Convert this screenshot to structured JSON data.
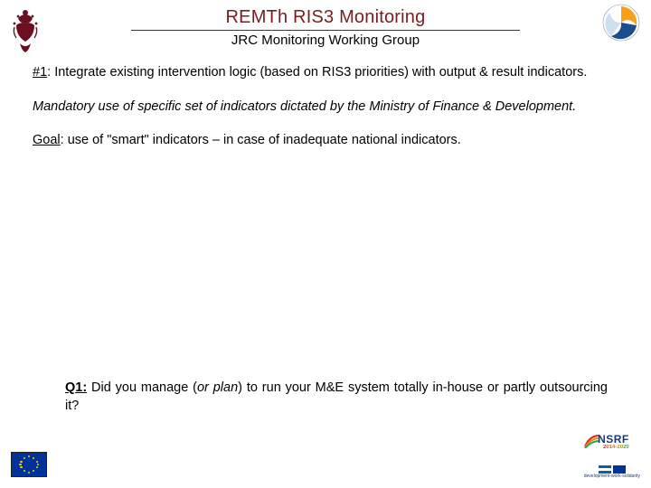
{
  "header": {
    "title": "REMTh RIS3 Monitoring",
    "subtitle": "JRC Monitoring Working Group"
  },
  "body": {
    "p1_prefix": "#1",
    "p1_rest": ": Integrate existing intervention logic (based on RIS3 priorities) with output & result indicators.",
    "p2": "Mandatory use of specific set of indicators dictated by the Ministry of Finance & Development.",
    "p3_goal": "Goal",
    "p3_rest": ": use of \"smart\" indicators – in case of inadequate national indicators."
  },
  "question": {
    "label": "Q1:",
    "pre": " Did you manage (",
    "em": "or plan",
    "post": ") to run your M&E system totally in-house or partly outsourcing it?"
  },
  "footer": {
    "nsrf_brand": "NSRF",
    "nsrf_years": "2014-2020",
    "nsrf_tagline": "development-work-solidarity"
  }
}
